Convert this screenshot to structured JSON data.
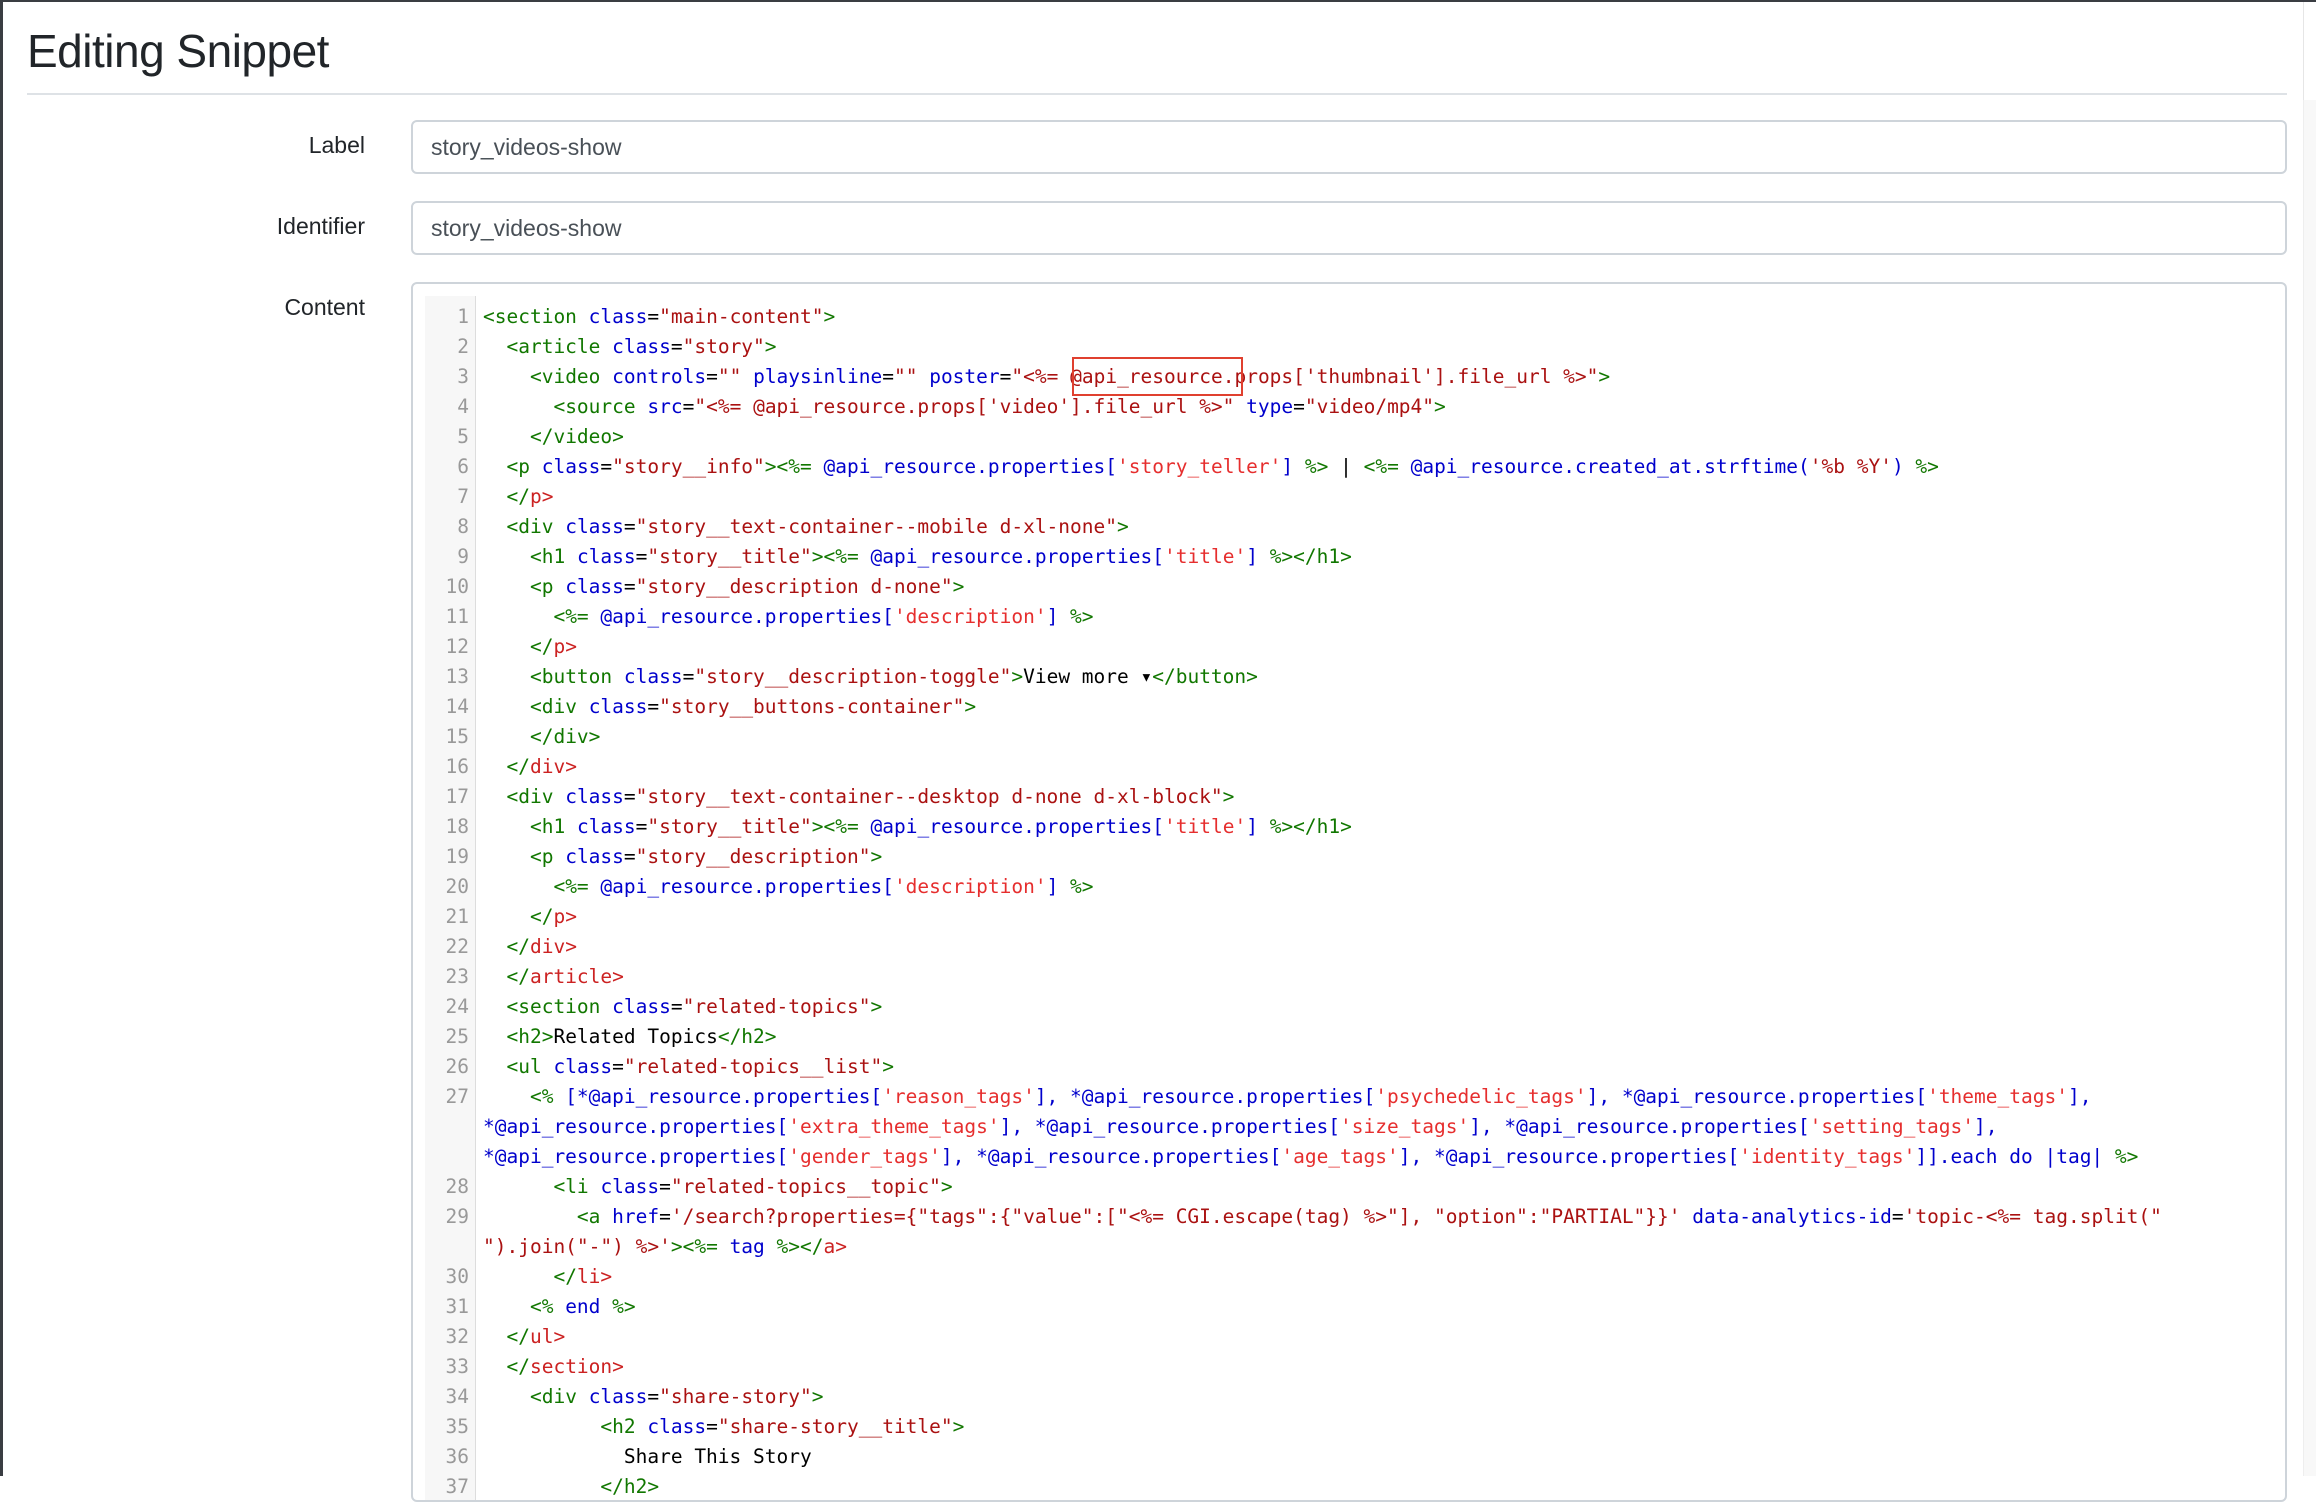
{
  "page": {
    "title": "Editing Snippet"
  },
  "form": {
    "label": {
      "label": "Label",
      "value": "story_videos-show"
    },
    "identifier": {
      "label": "Identifier",
      "value": "story_videos-show"
    },
    "content": {
      "label": "Content"
    }
  },
  "colors": {
    "tag": "#117700",
    "attribute": "#0000cc",
    "string": "#aa1111",
    "error_tag": "#cc2222",
    "highlight_box": "#e0402f"
  },
  "editor": {
    "highlighted_token": "@api_resource.",
    "lines": [
      {
        "n": "1",
        "tokens": [
          [
            "tg",
            "<section"
          ],
          [
            "pl",
            " "
          ],
          [
            "at",
            "class"
          ],
          [
            "pl",
            "="
          ],
          [
            "st",
            "\"main-content\""
          ],
          [
            "tg",
            ">"
          ]
        ]
      },
      {
        "n": "2",
        "tokens": [
          [
            "pl",
            "  "
          ],
          [
            "tg",
            "<article"
          ],
          [
            "pl",
            " "
          ],
          [
            "at",
            "class"
          ],
          [
            "pl",
            "="
          ],
          [
            "st",
            "\"story\""
          ],
          [
            "tg",
            ">"
          ]
        ]
      },
      {
        "n": "3",
        "tokens": [
          [
            "pl",
            "    "
          ],
          [
            "tg",
            "<video"
          ],
          [
            "pl",
            " "
          ],
          [
            "at",
            "controls"
          ],
          [
            "pl",
            "="
          ],
          [
            "st",
            "\"\""
          ],
          [
            "pl",
            " "
          ],
          [
            "at",
            "playsinline"
          ],
          [
            "pl",
            "="
          ],
          [
            "st",
            "\"\""
          ],
          [
            "pl",
            " "
          ],
          [
            "at",
            "poster"
          ],
          [
            "pl",
            "="
          ],
          [
            "st",
            "\"<%= @api_resource.props['thumbnail'].file_url %>\""
          ],
          [
            "tg",
            ">"
          ]
        ]
      },
      {
        "n": "4",
        "tokens": [
          [
            "pl",
            "      "
          ],
          [
            "tg",
            "<source"
          ],
          [
            "pl",
            " "
          ],
          [
            "at",
            "src"
          ],
          [
            "pl",
            "="
          ],
          [
            "st",
            "\"<%= @api_resource.props['video'].file_url %>\""
          ],
          [
            "pl",
            " "
          ],
          [
            "at",
            "type"
          ],
          [
            "pl",
            "="
          ],
          [
            "st",
            "\"video/mp4\""
          ],
          [
            "tg",
            ">"
          ]
        ]
      },
      {
        "n": "5",
        "tokens": [
          [
            "pl",
            "    "
          ],
          [
            "tg",
            "</video>"
          ]
        ]
      },
      {
        "n": "6",
        "tokens": [
          [
            "pl",
            "  "
          ],
          [
            "tg",
            "<p"
          ],
          [
            "pl",
            " "
          ],
          [
            "at",
            "class"
          ],
          [
            "pl",
            "="
          ],
          [
            "st",
            "\"story__info\""
          ],
          [
            "tg",
            ">"
          ],
          [
            "dl",
            "<%="
          ],
          [
            "rb",
            " @api_resource.properties["
          ],
          [
            "rs",
            "'story_teller'"
          ],
          [
            "rb",
            "] "
          ],
          [
            "dl",
            "%>"
          ],
          [
            "pl",
            " | "
          ],
          [
            "dl",
            "<%="
          ],
          [
            "rb",
            " @api_resource.created_at.strftime("
          ],
          [
            "st",
            "'%b %Y'"
          ],
          [
            "rb",
            ") "
          ],
          [
            "dl",
            "%>"
          ]
        ]
      },
      {
        "n": "7",
        "tokens": [
          [
            "pl",
            "  "
          ],
          [
            "tg",
            "</"
          ],
          [
            "er",
            "p>"
          ]
        ]
      },
      {
        "n": "8",
        "tokens": [
          [
            "pl",
            "  "
          ],
          [
            "tg",
            "<div"
          ],
          [
            "pl",
            " "
          ],
          [
            "at",
            "class"
          ],
          [
            "pl",
            "="
          ],
          [
            "st",
            "\"story__text-container--mobile d-xl-none\""
          ],
          [
            "tg",
            ">"
          ]
        ]
      },
      {
        "n": "9",
        "tokens": [
          [
            "pl",
            "    "
          ],
          [
            "tg",
            "<h1"
          ],
          [
            "pl",
            " "
          ],
          [
            "at",
            "class"
          ],
          [
            "pl",
            "="
          ],
          [
            "st",
            "\"story__title\""
          ],
          [
            "tg",
            ">"
          ],
          [
            "dl",
            "<%="
          ],
          [
            "rb",
            " @api_resource.properties["
          ],
          [
            "rs",
            "'title'"
          ],
          [
            "rb",
            "] "
          ],
          [
            "dl",
            "%>"
          ],
          [
            "tg",
            "</h1>"
          ]
        ]
      },
      {
        "n": "10",
        "tokens": [
          [
            "pl",
            "    "
          ],
          [
            "tg",
            "<p"
          ],
          [
            "pl",
            " "
          ],
          [
            "at",
            "class"
          ],
          [
            "pl",
            "="
          ],
          [
            "st",
            "\"story__description d-none\""
          ],
          [
            "tg",
            ">"
          ]
        ]
      },
      {
        "n": "11",
        "tokens": [
          [
            "pl",
            "      "
          ],
          [
            "dl",
            "<%="
          ],
          [
            "rb",
            " @api_resource.properties["
          ],
          [
            "rs",
            "'description'"
          ],
          [
            "rb",
            "] "
          ],
          [
            "dl",
            "%>"
          ]
        ]
      },
      {
        "n": "12",
        "tokens": [
          [
            "pl",
            "    "
          ],
          [
            "tg",
            "</"
          ],
          [
            "er",
            "p>"
          ]
        ]
      },
      {
        "n": "13",
        "tokens": [
          [
            "pl",
            "    "
          ],
          [
            "tg",
            "<button"
          ],
          [
            "pl",
            " "
          ],
          [
            "at",
            "class"
          ],
          [
            "pl",
            "="
          ],
          [
            "st",
            "\"story__description-toggle\""
          ],
          [
            "tg",
            ">"
          ],
          [
            "pl",
            "View more ▾"
          ],
          [
            "tg",
            "</button>"
          ]
        ]
      },
      {
        "n": "14",
        "tokens": [
          [
            "pl",
            "    "
          ],
          [
            "tg",
            "<div"
          ],
          [
            "pl",
            " "
          ],
          [
            "at",
            "class"
          ],
          [
            "pl",
            "="
          ],
          [
            "st",
            "\"story__buttons-container\""
          ],
          [
            "tg",
            ">"
          ]
        ]
      },
      {
        "n": "15",
        "tokens": [
          [
            "pl",
            "    "
          ],
          [
            "tg",
            "</div>"
          ]
        ]
      },
      {
        "n": "16",
        "tokens": [
          [
            "pl",
            "  "
          ],
          [
            "tg",
            "</"
          ],
          [
            "er",
            "div>"
          ]
        ]
      },
      {
        "n": "17",
        "tokens": [
          [
            "pl",
            "  "
          ],
          [
            "tg",
            "<div"
          ],
          [
            "pl",
            " "
          ],
          [
            "at",
            "class"
          ],
          [
            "pl",
            "="
          ],
          [
            "st",
            "\"story__text-container--desktop d-none d-xl-block\""
          ],
          [
            "tg",
            ">"
          ]
        ]
      },
      {
        "n": "18",
        "tokens": [
          [
            "pl",
            "    "
          ],
          [
            "tg",
            "<h1"
          ],
          [
            "pl",
            " "
          ],
          [
            "at",
            "class"
          ],
          [
            "pl",
            "="
          ],
          [
            "st",
            "\"story__title\""
          ],
          [
            "tg",
            ">"
          ],
          [
            "dl",
            "<%="
          ],
          [
            "rb",
            " @api_resource.properties["
          ],
          [
            "rs",
            "'title'"
          ],
          [
            "rb",
            "] "
          ],
          [
            "dl",
            "%>"
          ],
          [
            "tg",
            "</h1>"
          ]
        ]
      },
      {
        "n": "19",
        "tokens": [
          [
            "pl",
            "    "
          ],
          [
            "tg",
            "<p"
          ],
          [
            "pl",
            " "
          ],
          [
            "at",
            "class"
          ],
          [
            "pl",
            "="
          ],
          [
            "st",
            "\"story__description\""
          ],
          [
            "tg",
            ">"
          ]
        ]
      },
      {
        "n": "20",
        "tokens": [
          [
            "pl",
            "      "
          ],
          [
            "dl",
            "<%="
          ],
          [
            "rb",
            " @api_resource.properties["
          ],
          [
            "rs",
            "'description'"
          ],
          [
            "rb",
            "] "
          ],
          [
            "dl",
            "%>"
          ]
        ]
      },
      {
        "n": "21",
        "tokens": [
          [
            "pl",
            "    "
          ],
          [
            "tg",
            "</"
          ],
          [
            "er",
            "p>"
          ]
        ]
      },
      {
        "n": "22",
        "tokens": [
          [
            "pl",
            "  "
          ],
          [
            "tg",
            "</"
          ],
          [
            "er",
            "div>"
          ]
        ]
      },
      {
        "n": "23",
        "tokens": [
          [
            "pl",
            "  "
          ],
          [
            "tg",
            "</"
          ],
          [
            "er",
            "article>"
          ]
        ]
      },
      {
        "n": "24",
        "tokens": [
          [
            "pl",
            "  "
          ],
          [
            "tg",
            "<section"
          ],
          [
            "pl",
            " "
          ],
          [
            "at",
            "class"
          ],
          [
            "pl",
            "="
          ],
          [
            "st",
            "\"related-topics\""
          ],
          [
            "tg",
            ">"
          ]
        ]
      },
      {
        "n": "25",
        "tokens": [
          [
            "pl",
            "  "
          ],
          [
            "tg",
            "<h2>"
          ],
          [
            "pl",
            "Related Topics"
          ],
          [
            "tg",
            "</h2>"
          ]
        ]
      },
      {
        "n": "26",
        "tokens": [
          [
            "pl",
            "  "
          ],
          [
            "tg",
            "<ul"
          ],
          [
            "pl",
            " "
          ],
          [
            "at",
            "class"
          ],
          [
            "pl",
            "="
          ],
          [
            "st",
            "\"related-topics__list\""
          ],
          [
            "tg",
            ">"
          ]
        ]
      },
      {
        "n": "27",
        "tokens": [
          [
            "pl",
            "    "
          ],
          [
            "dl",
            "<%"
          ],
          [
            "rb",
            " [*@api_resource.properties["
          ],
          [
            "rs",
            "'reason_tags'"
          ],
          [
            "rb",
            "], *@api_resource.properties["
          ],
          [
            "rs",
            "'psychedelic_tags'"
          ],
          [
            "rb",
            "], *@api_resource.properties["
          ],
          [
            "rs",
            "'theme_tags'"
          ],
          [
            "rb",
            "],"
          ]
        ]
      },
      {
        "n": "",
        "tokens": [
          [
            "rb",
            "*@api_resource.properties["
          ],
          [
            "rs",
            "'extra_theme_tags'"
          ],
          [
            "rb",
            "], *@api_resource.properties["
          ],
          [
            "rs",
            "'size_tags'"
          ],
          [
            "rb",
            "], *@api_resource.properties["
          ],
          [
            "rs",
            "'setting_tags'"
          ],
          [
            "rb",
            "],"
          ]
        ]
      },
      {
        "n": "",
        "tokens": [
          [
            "rb",
            "*@api_resource.properties["
          ],
          [
            "rs",
            "'gender_tags'"
          ],
          [
            "rb",
            "], *@api_resource.properties["
          ],
          [
            "rs",
            "'age_tags'"
          ],
          [
            "rb",
            "], *@api_resource.properties["
          ],
          [
            "rs",
            "'identity_tags'"
          ],
          [
            "rb",
            "]].each do |tag| "
          ],
          [
            "dl",
            "%>"
          ]
        ]
      },
      {
        "n": "28",
        "tokens": [
          [
            "pl",
            "      "
          ],
          [
            "tg",
            "<li"
          ],
          [
            "pl",
            " "
          ],
          [
            "at",
            "class"
          ],
          [
            "pl",
            "="
          ],
          [
            "st",
            "\"related-topics__topic\""
          ],
          [
            "tg",
            ">"
          ]
        ]
      },
      {
        "n": "29",
        "tokens": [
          [
            "pl",
            "        "
          ],
          [
            "tg",
            "<a"
          ],
          [
            "pl",
            " "
          ],
          [
            "at",
            "href"
          ],
          [
            "pl",
            "="
          ],
          [
            "st",
            "'/search?properties={\"tags\":{\"value\":[\"<%= CGI.escape(tag) %>\"], \"option\":\"PARTIAL\"}}'"
          ],
          [
            "pl",
            " "
          ],
          [
            "at",
            "data-analytics-id"
          ],
          [
            "pl",
            "="
          ],
          [
            "st",
            "'topic-<%= tag.split(\""
          ]
        ]
      },
      {
        "n": "",
        "tokens": [
          [
            "st",
            "\").join(\"-\") %>'"
          ],
          [
            "tg",
            ">"
          ],
          [
            "dl",
            "<%="
          ],
          [
            "rb",
            " tag "
          ],
          [
            "dl",
            "%>"
          ],
          [
            "tg",
            "</"
          ],
          [
            "er",
            "a>"
          ]
        ]
      },
      {
        "n": "30",
        "tokens": [
          [
            "pl",
            "      "
          ],
          [
            "tg",
            "</"
          ],
          [
            "er",
            "li>"
          ]
        ]
      },
      {
        "n": "31",
        "tokens": [
          [
            "pl",
            "    "
          ],
          [
            "dl",
            "<%"
          ],
          [
            "rb",
            " end "
          ],
          [
            "dl",
            "%>"
          ]
        ]
      },
      {
        "n": "32",
        "tokens": [
          [
            "pl",
            "  "
          ],
          [
            "tg",
            "</"
          ],
          [
            "er",
            "ul>"
          ]
        ]
      },
      {
        "n": "33",
        "tokens": [
          [
            "pl",
            "  "
          ],
          [
            "tg",
            "</"
          ],
          [
            "er",
            "section>"
          ]
        ]
      },
      {
        "n": "34",
        "tokens": [
          [
            "pl",
            "    "
          ],
          [
            "tg",
            "<div"
          ],
          [
            "pl",
            " "
          ],
          [
            "at",
            "class"
          ],
          [
            "pl",
            "="
          ],
          [
            "st",
            "\"share-story\""
          ],
          [
            "tg",
            ">"
          ]
        ]
      },
      {
        "n": "35",
        "tokens": [
          [
            "pl",
            "          "
          ],
          [
            "tg",
            "<h2"
          ],
          [
            "pl",
            " "
          ],
          [
            "at",
            "class"
          ],
          [
            "pl",
            "="
          ],
          [
            "st",
            "\"share-story__title\""
          ],
          [
            "tg",
            ">"
          ]
        ]
      },
      {
        "n": "36",
        "tokens": [
          [
            "pl",
            "            Share This Story"
          ]
        ]
      },
      {
        "n": "37",
        "tokens": [
          [
            "pl",
            "          "
          ],
          [
            "tg",
            "</h2>"
          ]
        ]
      }
    ]
  }
}
